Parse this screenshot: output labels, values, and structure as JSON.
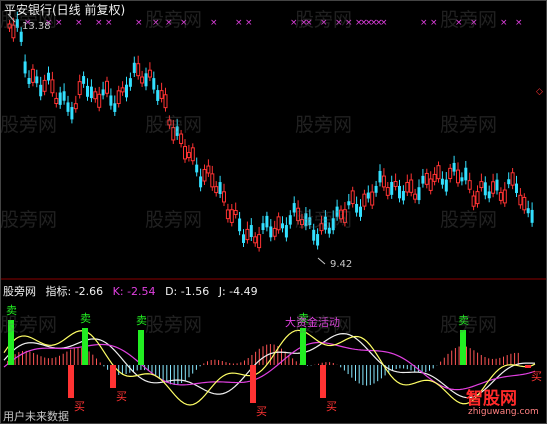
{
  "header": {
    "stock_title": "平安银行(日线 前复权)"
  },
  "main_chart": {
    "high_marker": "13.38",
    "low_marker": "9.42",
    "colors": {
      "up": "#ff3333",
      "down": "#33e0ff",
      "cross_marks": "#e040e0",
      "background": "#000000"
    }
  },
  "indicator_panel": {
    "source_name": "股旁网",
    "indicator_label": "指标: -2.66",
    "k_value": "K: -2.54",
    "d_value": "D: -1.56",
    "j_value": "J: -4.49",
    "colors": {
      "buy_bar": "#ff3333",
      "sell_bar": "#22ee22",
      "sell_text": "#22ee22",
      "buy_text": "#ff3333",
      "k_line": "#f0f0f0",
      "d_line": "#e040e0",
      "j_line": "#ffff66"
    },
    "sell_label": "卖",
    "buy_label": "买",
    "annotation": "大资金活动",
    "caption": "用户未来数据"
  },
  "watermark": "股旁网",
  "brand": {
    "name": "智股网",
    "url": "zhiguwang.com",
    "color": "#ff2a2a"
  }
}
